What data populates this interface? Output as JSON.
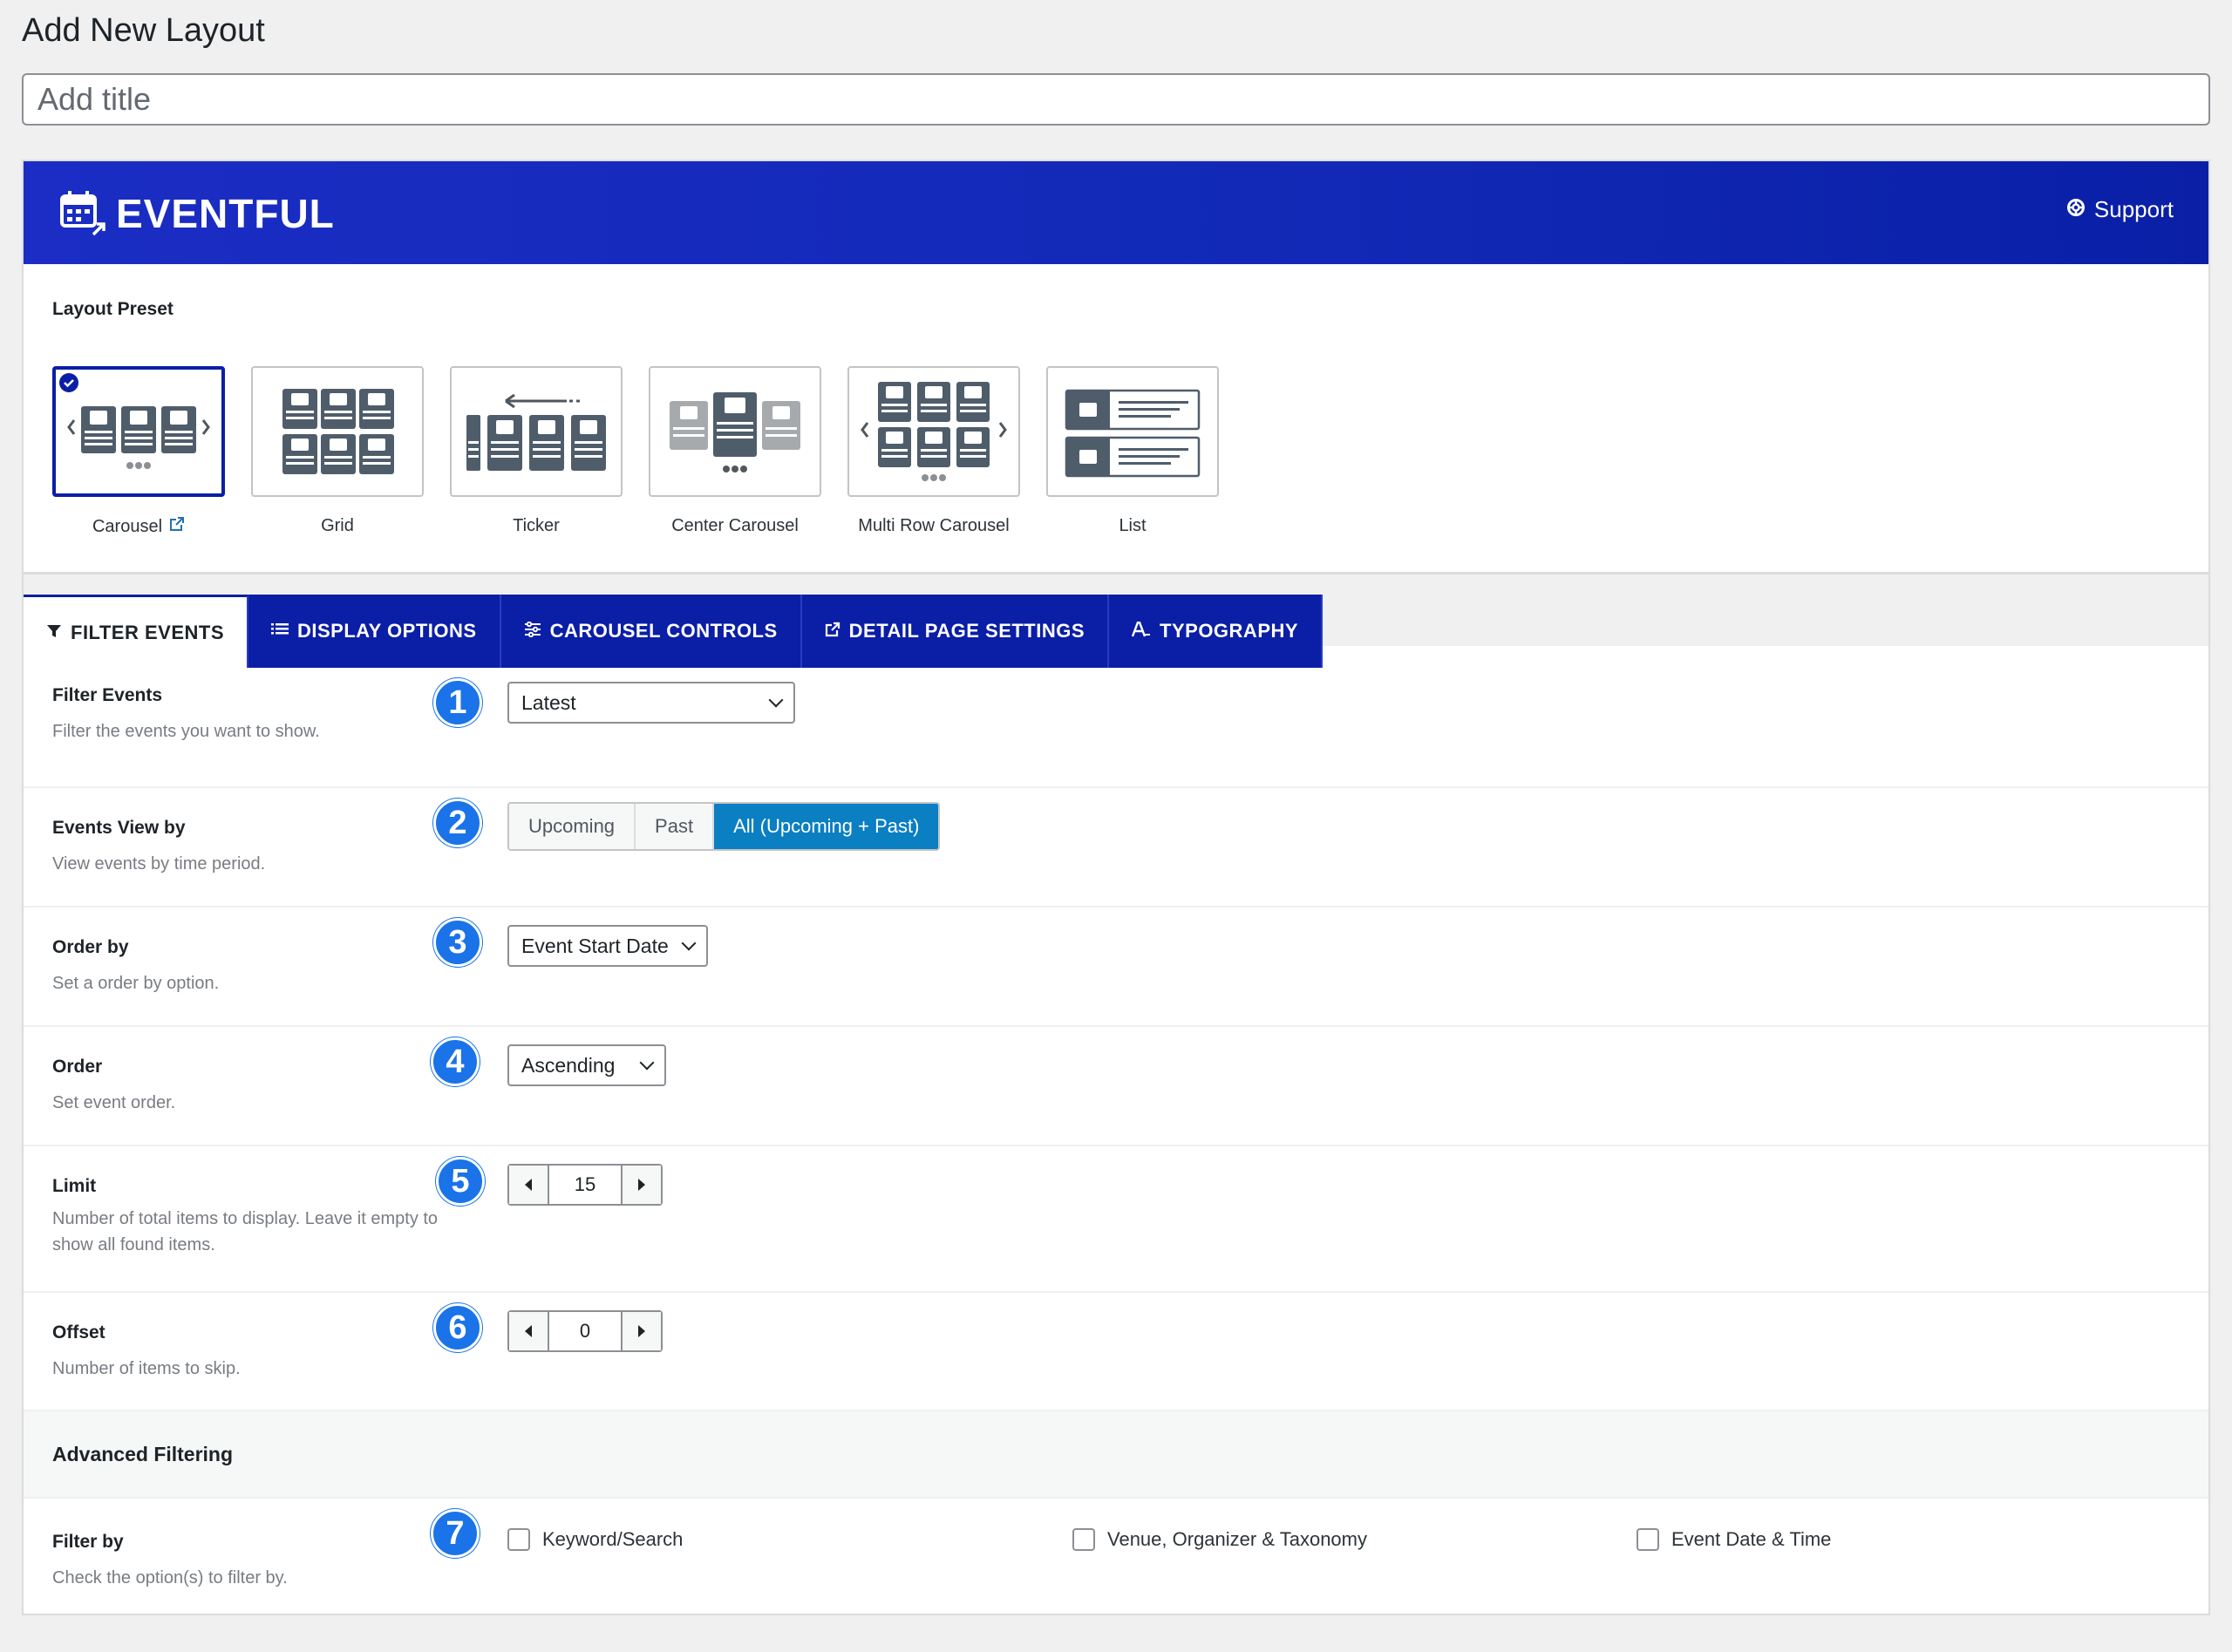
{
  "page": {
    "title": "Add New Layout",
    "title_placeholder": "Add title"
  },
  "header": {
    "brand": "EVENTFUL",
    "support_label": "Support",
    "color": "#1129b6"
  },
  "layout_preset": {
    "label": "Layout Preset",
    "items": [
      {
        "label": "Carousel",
        "selected": true
      },
      {
        "label": "Grid"
      },
      {
        "label": "Ticker"
      },
      {
        "label": "Center Carousel"
      },
      {
        "label": "Multi Row Carousel"
      },
      {
        "label": "List"
      }
    ]
  },
  "tabs": [
    {
      "label": "FILTER EVENTS",
      "icon": "filter-icon",
      "active": true
    },
    {
      "label": "DISPLAY OPTIONS",
      "icon": "list-icon"
    },
    {
      "label": "CAROUSEL CONTROLS",
      "icon": "sliders-icon"
    },
    {
      "label": "DETAIL PAGE SETTINGS",
      "icon": "external-link-icon"
    },
    {
      "label": "TYPOGRAPHY",
      "icon": "typography-icon"
    }
  ],
  "fields": {
    "filter_events": {
      "badge": "1",
      "label": "Filter Events",
      "desc": "Filter the events you want to show.",
      "value": "Latest"
    },
    "events_view": {
      "badge": "2",
      "label": "Events View by",
      "desc": "View events by time period.",
      "options": [
        "Upcoming",
        "Past",
        "All (Upcoming + Past)"
      ],
      "selected": "All (Upcoming + Past)"
    },
    "order_by": {
      "badge": "3",
      "label": "Order by",
      "desc": "Set a order by option.",
      "value": "Event Start Date"
    },
    "order": {
      "badge": "4",
      "label": "Order",
      "desc": "Set event order.",
      "value": "Ascending"
    },
    "limit": {
      "badge": "5",
      "label": "Limit",
      "desc": "Number of total items to display. Leave it empty to show all found items.",
      "value": "15"
    },
    "offset": {
      "badge": "6",
      "label": "Offset",
      "desc": "Number of items to skip.",
      "value": "0"
    }
  },
  "advanced": {
    "label": "Advanced Filtering",
    "filter_by": {
      "badge": "7",
      "label": "Filter by",
      "desc": "Check the option(s) to filter by.",
      "options": [
        "Keyword/Search",
        "Venue, Organizer & Taxonomy",
        "Event Date & Time"
      ]
    }
  },
  "colors": {
    "accent": "#0b1ea6",
    "segment_on": "#0a7fc2",
    "badge": "#1a73e8"
  }
}
